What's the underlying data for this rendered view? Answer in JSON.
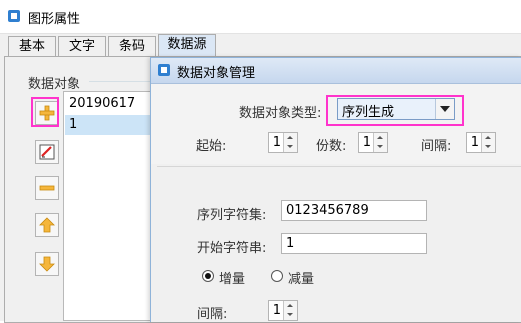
{
  "window": {
    "title": "图形属性"
  },
  "tabs": [
    "基本",
    "文字",
    "条码",
    "数据源"
  ],
  "active_tab": "数据源",
  "data_objects": {
    "group_label": "数据对象",
    "items": [
      "20190617",
      "1"
    ],
    "selected_item": "1",
    "tools": [
      "add-icon",
      "edit-icon",
      "delete-icon",
      "move-up-icon",
      "move-down-icon"
    ]
  },
  "dialog": {
    "title": "数据对象管理",
    "type_label": "数据对象类型:",
    "type_value": "序列生成",
    "start_label": "起始:",
    "start_value": "1",
    "copies_label": "份数:",
    "copies_value": "1",
    "interval_label": "间隔:",
    "interval_value": "1",
    "charset_label": "序列字符集:",
    "charset_value": "0123456789",
    "start_string_label": "开始字符串:",
    "start_string_value": "1",
    "increase_label": "增量",
    "decrease_label": "减量",
    "mode_selected": "增量",
    "step_label": "间隔:",
    "step_value": "1"
  },
  "colors": {
    "highlight": "#ff33cc",
    "selection": "#cce4f7",
    "arrow_fill": "#f5b63b"
  }
}
